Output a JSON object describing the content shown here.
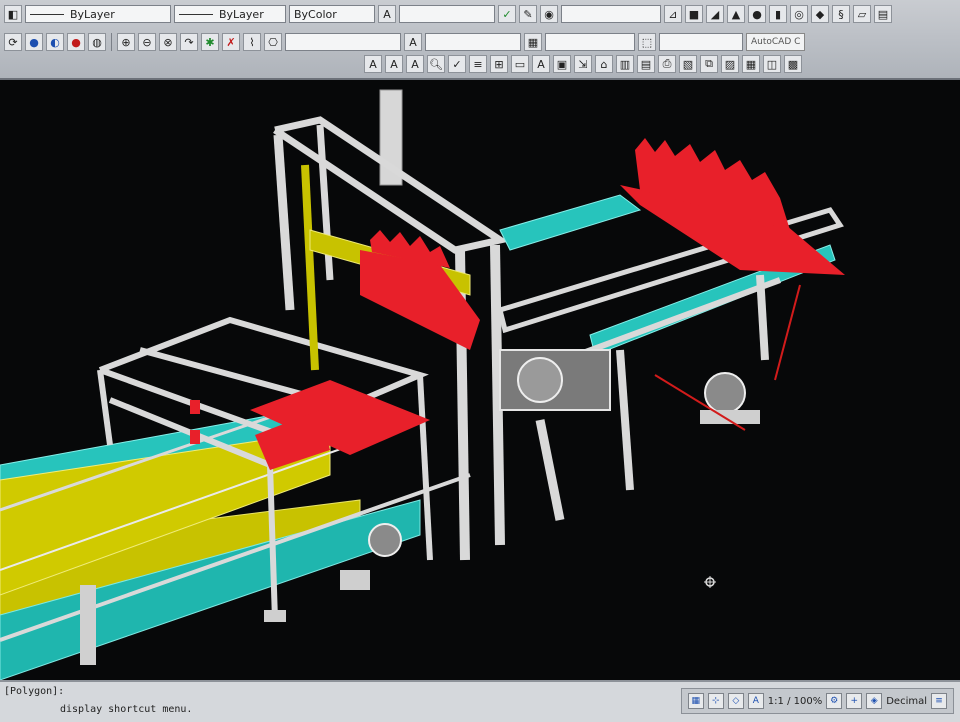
{
  "ribbon": {
    "layer_combo": "ByLayer",
    "linetype_combo": "ByLayer",
    "color_combo": "ByColor",
    "app_name": "AutoCAD C"
  },
  "command_line": {
    "line1": "[Polygon]:",
    "line2": "display shortcut menu."
  },
  "status_bar": {
    "scale": "1:1 / 100%",
    "units": "Decimal"
  },
  "colors": {
    "frame": "#d9d9d9",
    "conveyor_yellow": "#d8d200",
    "conveyor_cyan": "#2cc8c0",
    "parts_red": "#e8202a",
    "background": "#070809"
  }
}
